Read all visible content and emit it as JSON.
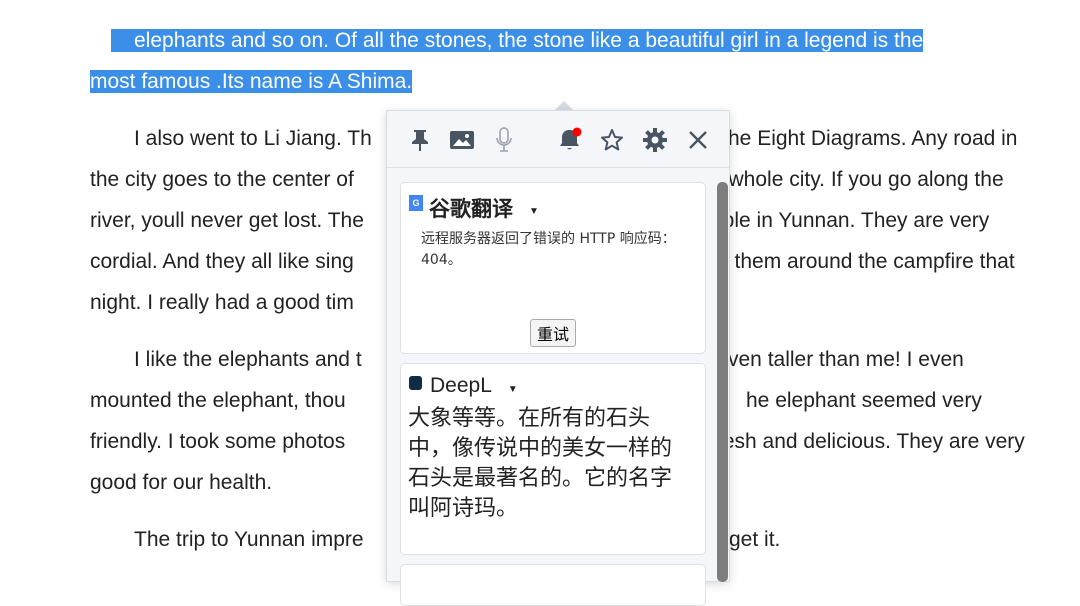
{
  "article": {
    "selected": [
      "elephants and so on. Of all the stones, the stone like a beautiful girl in a legend is the",
      "most famous .Its name is A Shima."
    ],
    "lines_left": [
      "I also went to Li Jiang. Th",
      "the city goes to the center of",
      "river, youll never get lost. The",
      "cordial. And they all like sing",
      "night. I really had a good tim",
      "I like the elephants and t",
      "mounted the elephant, thou",
      "friendly. I took some photos",
      "good for our health.",
      "The trip to Yunnan impre"
    ],
    "lines_right": [
      "he Eight Diagrams. Any road in",
      "e whole city. If you go along the",
      "ople in Yunnan. They are very",
      "h them around the campfire that",
      "",
      "ven taller than me! I even",
      "he elephant seemed very",
      "fresh and delicious. They are very",
      "",
      "get it."
    ]
  },
  "popup": {
    "toolbar": [
      "pin-icon",
      "image-icon",
      "microphone-icon",
      "bell-icon",
      "star-icon",
      "gear-icon",
      "close-icon"
    ],
    "notification_color": "#ff0000",
    "google": {
      "title": "谷歌翻译",
      "error": "远程服务器返回了错误的 HTTP 响应码：404。",
      "retry": "重试"
    },
    "deepl": {
      "title": "DeepL",
      "text": "大象等等。在所有的石头中，像传说中的美女一样的石头是最著名的。它的名字叫阿诗玛。"
    }
  }
}
